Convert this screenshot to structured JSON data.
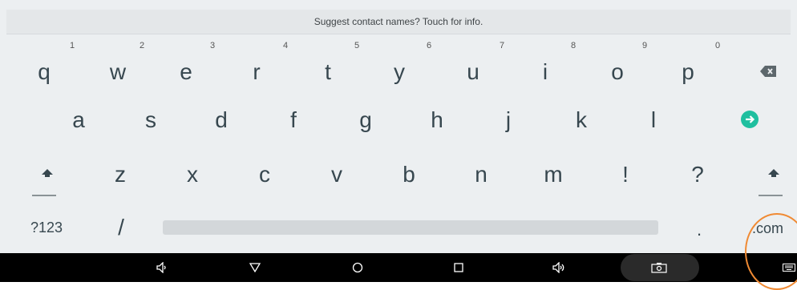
{
  "suggestion_bar": {
    "text": "Suggest contact names? Touch for info."
  },
  "keyboard": {
    "row1": [
      {
        "label": "q",
        "hint": "1"
      },
      {
        "label": "w",
        "hint": "2"
      },
      {
        "label": "e",
        "hint": "3"
      },
      {
        "label": "r",
        "hint": "4"
      },
      {
        "label": "t",
        "hint": "5"
      },
      {
        "label": "y",
        "hint": "6"
      },
      {
        "label": "u",
        "hint": "7"
      },
      {
        "label": "i",
        "hint": "8"
      },
      {
        "label": "o",
        "hint": "9"
      },
      {
        "label": "p",
        "hint": "0"
      }
    ],
    "row2": [
      "a",
      "s",
      "d",
      "f",
      "g",
      "h",
      "j",
      "k",
      "l"
    ],
    "row3": [
      "z",
      "x",
      "c",
      "v",
      "b",
      "n",
      "m",
      "!",
      "?"
    ],
    "row4": {
      "symbols": "?123",
      "slash": "/",
      "period": ".",
      "dotcom": ".com"
    },
    "icons": {
      "backspace": "backspace-icon",
      "enter": "enter-arrow-icon",
      "shift": "shift-icon"
    },
    "accent_color": "#1fbf9f"
  },
  "navbar": {
    "icons": [
      "volume-down-icon",
      "back-icon",
      "home-icon",
      "recents-icon",
      "volume-up-icon",
      "screenshot-icon",
      "keyboard-icon"
    ]
  },
  "highlight_color": "#f08a33"
}
